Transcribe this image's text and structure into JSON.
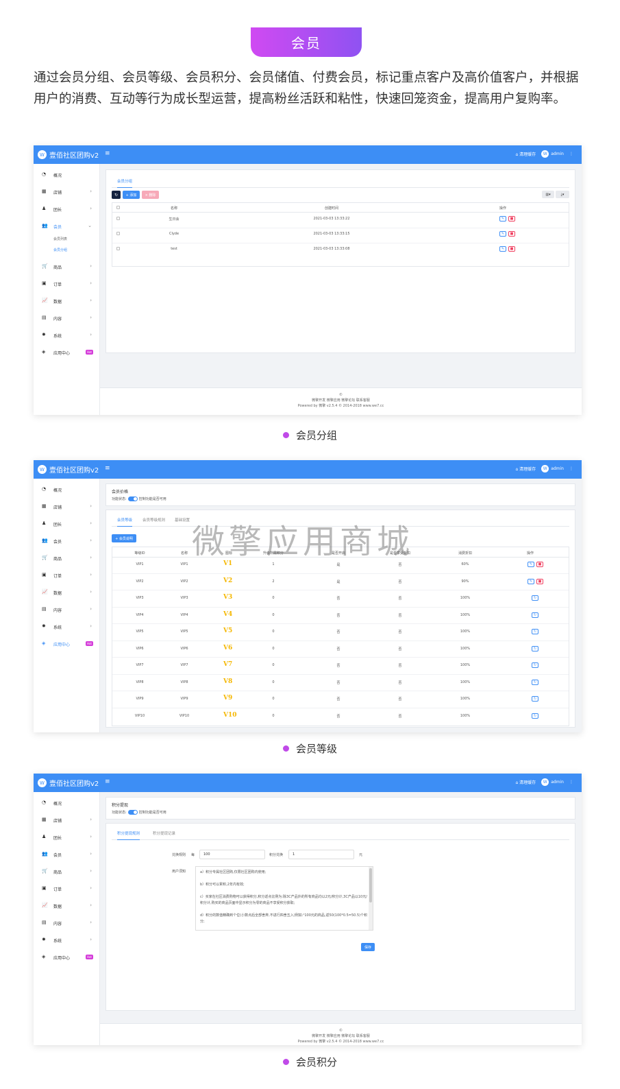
{
  "header": {
    "title": "会员",
    "intro": "通过会员分组、会员等级、会员积分、会员储值、付费会员，标记重点客户及高价值客户，并根据用户的消费、互动等行为成长型运营，提高粉丝活跃和粘性，快速回笼资金，提高用户复购率。"
  },
  "app": {
    "brand": "壹佰社区团购v2",
    "clear_cache": "清理缓存",
    "admin": "admin",
    "nav": [
      {
        "icon": "dashboard-icon",
        "label": "概况"
      },
      {
        "icon": "store-icon",
        "label": "店铺"
      },
      {
        "icon": "leader-icon",
        "label": "团长"
      },
      {
        "icon": "members-icon",
        "label": "会员"
      },
      {
        "icon": "cart-icon",
        "label": "商品"
      },
      {
        "icon": "order-icon",
        "label": "订单"
      },
      {
        "icon": "chart-icon",
        "label": "数据"
      },
      {
        "icon": "content-icon",
        "label": "内容"
      },
      {
        "icon": "gear-icon",
        "label": "系统"
      },
      {
        "icon": "app-center-icon",
        "label": "应用中心",
        "badge": "Hot"
      }
    ],
    "member_sub": [
      "会员列表",
      "会员分组"
    ],
    "footer_line1": "微擎开发 微擎应用 微擎论坛 联系客服",
    "footer_line2": "Powered by 微擎 v2.5.4 © 2014-2018 www.we7.cc"
  },
  "shot1": {
    "tab": "会员分组",
    "add": "+ 添加",
    "del": "× 删除",
    "cols": [
      "名称",
      "创建时间",
      "操作"
    ],
    "rows": [
      {
        "name": "生日会",
        "time": "2021-03-03 13:33:22"
      },
      {
        "name": "Clyde",
        "time": "2021-03-03 13:33:15"
      },
      {
        "name": "test",
        "time": "2021-03-03 13:33:08"
      }
    ],
    "caption": "会员分组"
  },
  "shot2": {
    "panel_title": "会员价格",
    "status_label": "功能状态:",
    "status_hint": "控制功能是否可用",
    "tabs": [
      "会员等级",
      "会员等级规则",
      "基础设置"
    ],
    "add": "+ 会员说明",
    "cols": [
      "等级ID",
      "名称",
      "图标",
      "升级所需积分",
      "是否开启",
      "是否享受折扣",
      "消费折扣",
      "操作"
    ],
    "rows": [
      {
        "id": "VIP1",
        "name": "VIP1",
        "icon": "V1",
        "pts": "1",
        "open": "是",
        "disc": "否",
        "rate": "60%"
      },
      {
        "id": "VIP2",
        "name": "VIP2",
        "icon": "V2",
        "pts": "2",
        "open": "是",
        "disc": "否",
        "rate": "90%"
      },
      {
        "id": "VIP3",
        "name": "VIP3",
        "icon": "V3",
        "pts": "0",
        "open": "否",
        "disc": "否",
        "rate": "100%"
      },
      {
        "id": "VIP4",
        "name": "VIP4",
        "icon": "V4",
        "pts": "0",
        "open": "否",
        "disc": "否",
        "rate": "100%"
      },
      {
        "id": "VIP5",
        "name": "VIP5",
        "icon": "V5",
        "pts": "0",
        "open": "否",
        "disc": "否",
        "rate": "100%"
      },
      {
        "id": "VIP6",
        "name": "VIP6",
        "icon": "V6",
        "pts": "0",
        "open": "否",
        "disc": "否",
        "rate": "100%"
      },
      {
        "id": "VIP7",
        "name": "VIP7",
        "icon": "V7",
        "pts": "0",
        "open": "否",
        "disc": "否",
        "rate": "100%"
      },
      {
        "id": "VIP8",
        "name": "VIP8",
        "icon": "V8",
        "pts": "0",
        "open": "否",
        "disc": "否",
        "rate": "100%"
      },
      {
        "id": "VIP9",
        "name": "VIP9",
        "icon": "V9",
        "pts": "0",
        "open": "否",
        "disc": "否",
        "rate": "100%"
      },
      {
        "id": "VIP10",
        "name": "VIP10",
        "icon": "V10",
        "pts": "0",
        "open": "否",
        "disc": "否",
        "rate": "100%"
      }
    ],
    "watermark": "微擎应用商城",
    "caption": "会员等级"
  },
  "shot3": {
    "panel_title": "积分提现",
    "status_label": "功能状态:",
    "status_hint": "控制功能是否可用",
    "tabs": [
      "积分提现规则",
      "积分提现记录"
    ],
    "rule_label": "兑换规则",
    "every": "每",
    "points_value": "100",
    "points_label": "积分兑换",
    "money_value": "1",
    "unit": "元",
    "notice_label": "用户须知",
    "notice": [
      "a）积分专属社区团购,仅限社区团购内使用;",
      "b）积分可以累积,2年内有效;",
      "c）买家在社区消费购物可以获得积分,积分返点比例为:除3C产品外的所有商品均以2元/积分计,3C产品以10元/积分计,购买的商品页面中显示积分为零的商品不享受积分获取;",
      "d）积分的数值精确到个位(小数点后全部舍弃,不进行四舍五入)例如:¹100元的商品,返50(100*0.5=50.5)个积分;"
    ],
    "save": "保存",
    "caption": "会员积分"
  }
}
